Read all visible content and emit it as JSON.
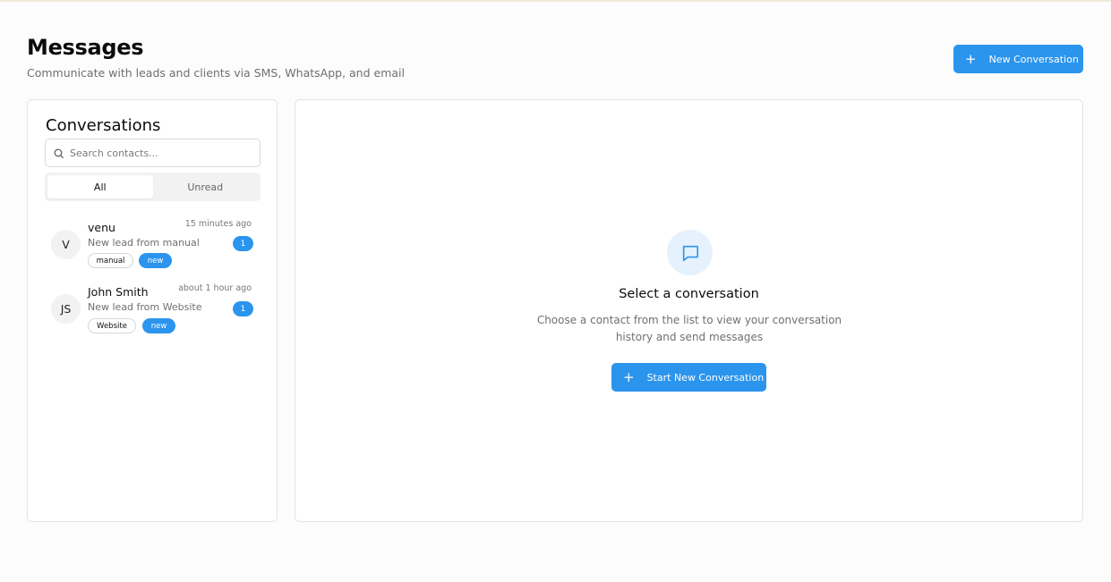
{
  "header": {
    "title": "Messages",
    "subtitle": "Communicate with leads and clients via SMS, WhatsApp, and email",
    "new_conversation_label": "New Conversation",
    "new_conversation_icon": "plus-icon"
  },
  "sidebar": {
    "title": "Conversations",
    "search": {
      "placeholder": "Search contacts...",
      "value": "",
      "icon": "search-icon"
    },
    "tabs": [
      {
        "label": "All",
        "active": true
      },
      {
        "label": "Unread",
        "active": false
      }
    ],
    "conversations": [
      {
        "initials": "V",
        "name": "venu",
        "time": "15 minutes ago",
        "preview": "New lead from manual",
        "unread": "1",
        "source_tag": "manual",
        "status_tag": "new"
      },
      {
        "initials": "JS",
        "name": "John Smith",
        "time": "about 1 hour ago",
        "preview": "New lead from Website",
        "unread": "1",
        "source_tag": "Website",
        "status_tag": "new"
      }
    ]
  },
  "main": {
    "empty_icon": "message-square-icon",
    "empty_title": "Select a conversation",
    "empty_description": "Choose a contact from the list to view your conversation history and send messages",
    "start_button_label": "Start New Conversation",
    "start_button_icon": "plus-icon"
  },
  "colors": {
    "accent": "#2b95ee",
    "accent_light": "#e5f1fc",
    "border": "#e4e4e4",
    "muted_text": "#6f6f6f"
  }
}
